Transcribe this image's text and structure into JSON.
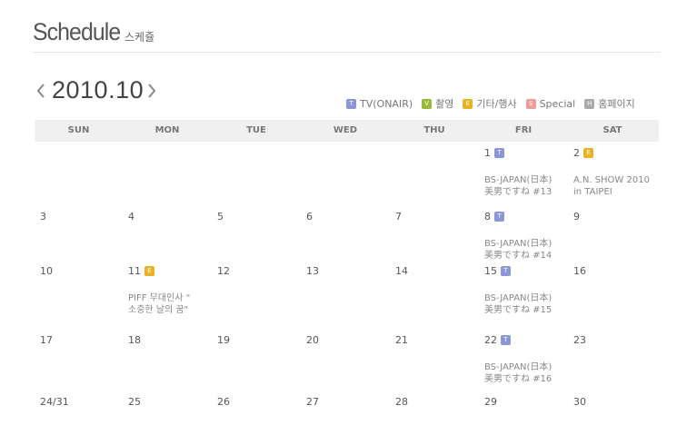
{
  "page": {
    "title": "Schedule",
    "subtitle": "스케쥴"
  },
  "calendar": {
    "month_label": "2010.10",
    "weekdays": [
      "SUN",
      "MON",
      "TUE",
      "WED",
      "THU",
      "FRI",
      "SAT"
    ]
  },
  "legend": [
    {
      "code": "T",
      "label": "TV(ONAIR)",
      "color": "#8a96d8"
    },
    {
      "code": "V",
      "label": "촬영",
      "color": "#9ab83a"
    },
    {
      "code": "E",
      "label": "기타/행사",
      "color": "#e8b222"
    },
    {
      "code": "S",
      "label": "Special",
      "color": "#ee9a9a"
    },
    {
      "code": "H",
      "label": "홈페이지",
      "color": "#aaaaaa"
    }
  ],
  "weeks": [
    {
      "days": [
        {
          "num": ""
        },
        {
          "num": ""
        },
        {
          "num": ""
        },
        {
          "num": ""
        },
        {
          "num": ""
        },
        {
          "num": "1",
          "badge": "T",
          "event": [
            "BS-JAPAN(日本)",
            "美男ですね #13"
          ]
        },
        {
          "num": "2",
          "badge": "E",
          "event": [
            "A.N. SHOW 2010",
            "in TAIPEI"
          ]
        }
      ]
    },
    {
      "days": [
        {
          "num": "3"
        },
        {
          "num": "4"
        },
        {
          "num": "5"
        },
        {
          "num": "6"
        },
        {
          "num": "7"
        },
        {
          "num": "8",
          "badge": "T",
          "event": [
            "BS-JAPAN(日本)",
            "美男ですね #14"
          ]
        },
        {
          "num": "9"
        }
      ]
    },
    {
      "days": [
        {
          "num": "10"
        },
        {
          "num": "11",
          "badge": "E",
          "event": [
            "PIFF 무대인사 \"",
            "소중한 날의 꿈\""
          ]
        },
        {
          "num": "12"
        },
        {
          "num": "13"
        },
        {
          "num": "14"
        },
        {
          "num": "15",
          "badge": "T",
          "event": [
            "BS-JAPAN(日本)",
            "美男ですね #15"
          ]
        },
        {
          "num": "16"
        }
      ]
    },
    {
      "days": [
        {
          "num": "17"
        },
        {
          "num": "18"
        },
        {
          "num": "19"
        },
        {
          "num": "20"
        },
        {
          "num": "21"
        },
        {
          "num": "22",
          "badge": "T",
          "event": [
            "BS-JAPAN(日本)",
            "美男ですね #16"
          ]
        },
        {
          "num": "23"
        }
      ]
    },
    {
      "days": [
        {
          "num": "24/31"
        },
        {
          "num": "25"
        },
        {
          "num": "26"
        },
        {
          "num": "27"
        },
        {
          "num": "28"
        },
        {
          "num": "29"
        },
        {
          "num": "30"
        }
      ]
    }
  ]
}
